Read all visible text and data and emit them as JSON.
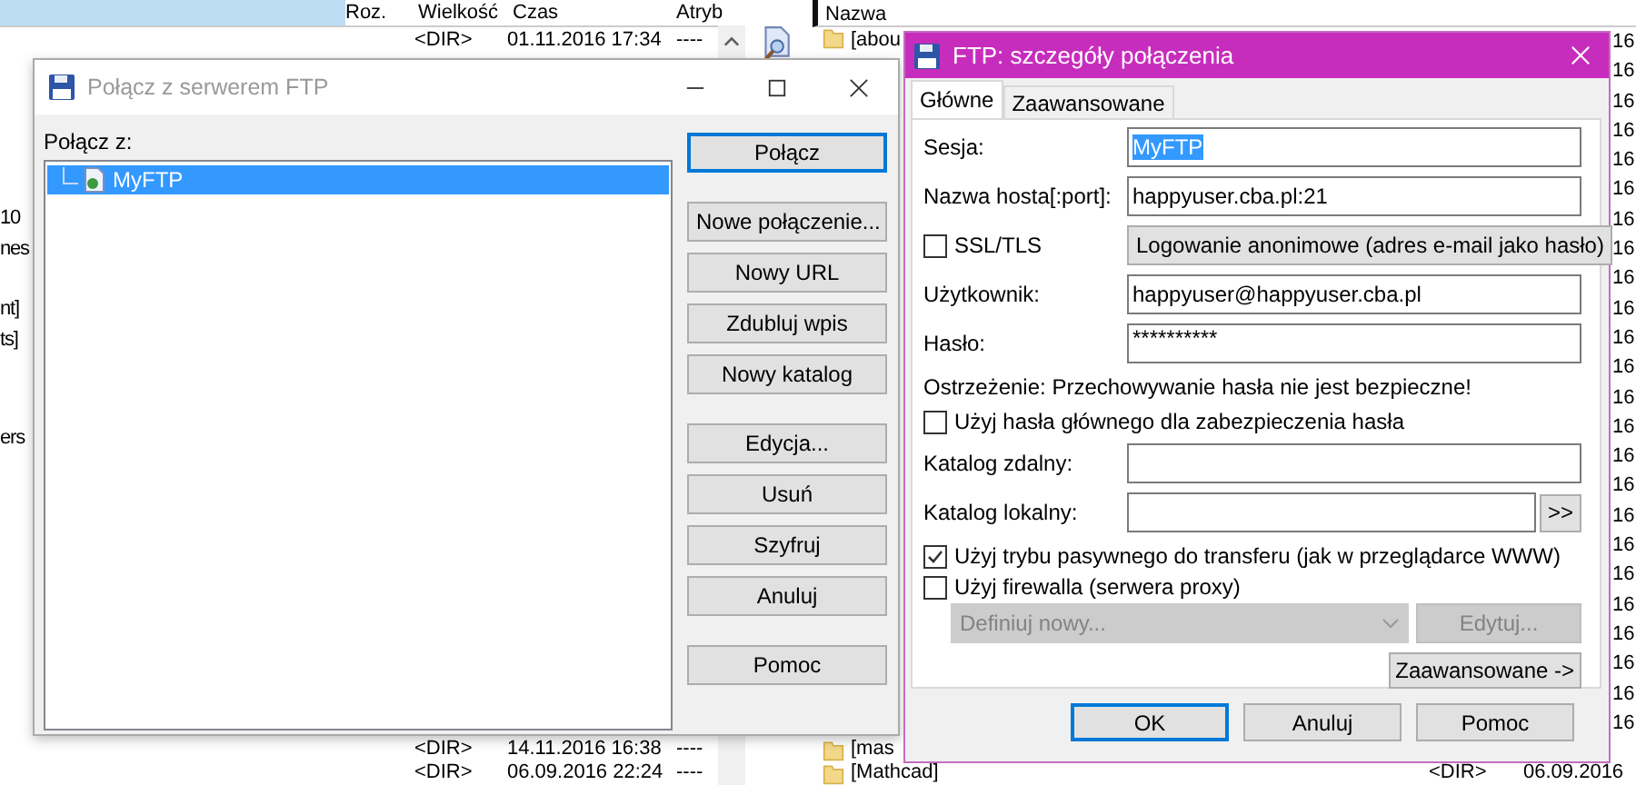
{
  "left_panel": {
    "columns": [
      "Roz.",
      "Wielkość",
      "Czas",
      "Atryb"
    ],
    "top_rows": [
      {
        "size": "<DIR>",
        "time": "01.11.2016 17:34",
        "attr": "----"
      }
    ],
    "name_fragments": [
      "10",
      "nes",
      "nt]",
      "ts]",
      "ers"
    ],
    "bottom_rows": [
      {
        "size": "<DIR>",
        "time": "14.11.2016 16:38",
        "attr": "----"
      },
      {
        "size": "<DIR>",
        "time": "06.09.2016 22:24",
        "attr": "----"
      }
    ]
  },
  "right_panel": {
    "columns": [
      "Nazwa"
    ],
    "top_rows": [
      {
        "name": "[abou"
      }
    ],
    "bottom_rows": [
      {
        "name": "[mas"
      },
      {
        "name": "[Mathcad]",
        "size": "<DIR>",
        "time": "06.09.2016"
      }
    ],
    "time_fragments": [
      "16",
      "16",
      "16",
      "16",
      "16",
      "16",
      "16",
      "16",
      "16",
      "16",
      "16",
      "16",
      "16",
      "16",
      "16",
      "16",
      "16",
      "16",
      "16",
      "16",
      "16",
      "16",
      "16",
      "16"
    ]
  },
  "connect_dialog": {
    "title": "Połącz z serwerem FTP",
    "label": "Połącz z:",
    "tree": [
      {
        "name": "MyFTP",
        "selected": true
      }
    ],
    "button_groups": [
      [
        {
          "label": "Połącz",
          "default": true
        }
      ],
      [
        {
          "label": "Nowe połączenie...",
          "default": false
        },
        {
          "label": "Nowy URL",
          "default": false
        },
        {
          "label": "Zdubluj wpis",
          "default": false
        },
        {
          "label": "Nowy katalog",
          "default": false
        }
      ],
      [
        {
          "label": "Edycja...",
          "default": false
        },
        {
          "label": "Usuń",
          "default": false
        },
        {
          "label": "Szyfruj",
          "default": false
        },
        {
          "label": "Anuluj",
          "default": false
        }
      ],
      [
        {
          "label": "Pomoc",
          "default": false
        }
      ]
    ]
  },
  "details_dialog": {
    "title": "FTP: szczegóły połączenia",
    "tabs": [
      {
        "label": "Główne",
        "selected": true
      },
      {
        "label": "Zaawansowane",
        "selected": false
      }
    ],
    "session": {
      "label": "Sesja:",
      "value": "MyFTP",
      "highlighted": true
    },
    "host": {
      "label": "Nazwa hosta[:port]:",
      "value": "happyuser.cba.pl:21"
    },
    "ssl": {
      "label": "SSL/TLS",
      "checked": false
    },
    "anonymous_button": "Logowanie anonimowe (adres e-mail jako hasło)",
    "user": {
      "label": "Użytkownik:",
      "value": "happyuser@happyuser.cba.pl"
    },
    "password": {
      "label": "Hasło:",
      "value": "**********"
    },
    "warning": "Ostrzeżenie: Przechowywanie hasła nie jest bezpieczne!",
    "master_password": {
      "label": "Użyj hasła głównego dla zabezpieczenia hasła",
      "checked": false
    },
    "remote_dir": {
      "label": "Katalog zdalny:"
    },
    "local_dir": {
      "label": "Katalog lokalny:"
    },
    "browse_button": ">>",
    "passive": {
      "label": "Użyj trybu pasywnego do transferu (jak w przeglądarce WWW)",
      "checked": true
    },
    "firewall": {
      "label": "Użyj firewalla (serwera proxy)",
      "checked": false
    },
    "proxy_dropdown": {
      "value": "Definiuj nowy...",
      "disabled": true
    },
    "edit_button": {
      "label": "Edytuj...",
      "disabled": true
    },
    "advanced_button": "Zaawansowane ->",
    "buttons": [
      {
        "label": "OK",
        "default": true
      },
      {
        "label": "Anuluj",
        "default": false
      },
      {
        "label": "Pomoc",
        "default": false
      }
    ]
  }
}
